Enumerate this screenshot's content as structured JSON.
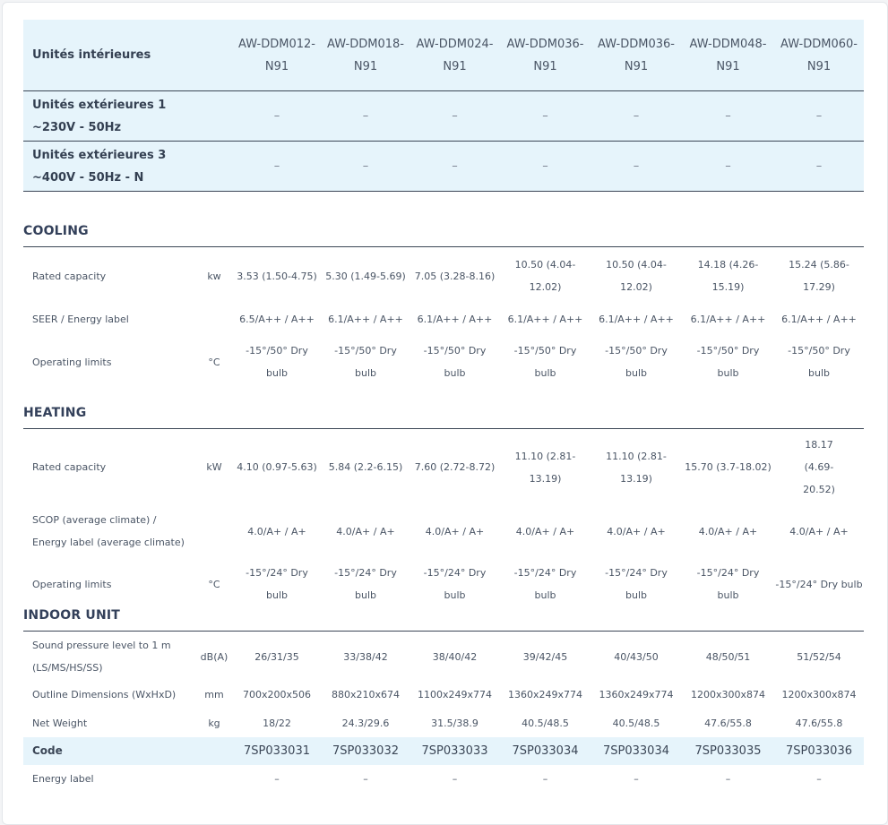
{
  "models": [
    "AW-DDM012-N91",
    "AW-DDM018-N91",
    "AW-DDM024-N91",
    "AW-DDM036-N91",
    "AW-DDM036-N91",
    "AW-DDM048-N91",
    "AW-DDM060-N91"
  ],
  "header": {
    "indoor_label": "Unités intérieures",
    "outdoor1_label_line1": "Unités extérieures 1",
    "outdoor1_label_line2": "~230V - 50Hz",
    "outdoor3_label_line1": "Unités extérieures 3",
    "outdoor3_label_line2": "~400V - 50Hz - N",
    "outdoor1_values": [
      "–",
      "–",
      "–",
      "–",
      "–",
      "–",
      "–"
    ],
    "outdoor3_values": [
      "–",
      "–",
      "–",
      "–",
      "–",
      "–",
      "–"
    ]
  },
  "cooling": {
    "title": "COOLING",
    "rated_capacity": {
      "label": "Rated capacity",
      "unit": "kw",
      "values": [
        "3.53 (1.50-4.75)",
        "5.30 (1.49-5.69)",
        "7.05 (3.28-8.16)",
        "10.50 (4.04-12.02)",
        "10.50 (4.04-12.02)",
        "14.18 (4.26-15.19)",
        "15.24 (5.86-17.29)"
      ]
    },
    "seer": {
      "label": "SEER / Energy label",
      "unit": "",
      "values": [
        "6.5/A++ / A++",
        "6.1/A++ / A++",
        "6.1/A++ / A++",
        "6.1/A++ / A++",
        "6.1/A++ / A++",
        "6.1/A++ / A++",
        "6.1/A++ / A++"
      ]
    },
    "operating_limits": {
      "label": "Operating limits",
      "unit": "°C",
      "values": [
        "-15°/50° Dry bulb",
        "-15°/50° Dry bulb",
        "-15°/50° Dry bulb",
        "-15°/50° Dry bulb",
        "-15°/50° Dry bulb",
        "-15°/50° Dry bulb",
        "-15°/50° Dry bulb"
      ]
    }
  },
  "heating": {
    "title": "HEATING",
    "rated_capacity": {
      "label": "Rated capacity",
      "unit": "kW",
      "values": [
        "4.10 (0.97-5.63)",
        "5.84 (2.2-6.15)",
        "7.60 (2.72-8.72)",
        "11.10 (2.81-13.19)",
        "11.10 (2.81-13.19)",
        "15.70 (3.7-18.02)",
        "18.17 (4.69-20.52)"
      ]
    },
    "scop": {
      "label": "SCOP (average climate) / Energy label (average climate)",
      "unit": "",
      "values": [
        "4.0/A+ / A+",
        "4.0/A+ / A+",
        "4.0/A+ / A+",
        "4.0/A+ / A+",
        "4.0/A+ / A+",
        "4.0/A+ / A+",
        "4.0/A+ / A+"
      ]
    },
    "operating_limits": {
      "label": "Operating limits",
      "unit": "°C",
      "values": [
        "-15°/24° Dry bulb",
        "-15°/24° Dry bulb",
        "-15°/24° Dry bulb",
        "-15°/24° Dry bulb",
        "-15°/24° Dry bulb",
        "-15°/24° Dry bulb",
        "-15°/24° Dry bulb"
      ]
    }
  },
  "indoor": {
    "title": "INDOOR UNIT",
    "sound": {
      "label": "Sound pressure level to 1 m (LS/MS/HS/SS)",
      "unit": "dB(A)",
      "values": [
        "26/31/35",
        "33/38/42",
        "38/40/42",
        "39/42/45",
        "40/43/50",
        "48/50/51",
        "51/52/54"
      ]
    },
    "dimensions": {
      "label": "Outline Dimensions (WxHxD)",
      "unit": "mm",
      "values": [
        "700x200x506",
        "880x210x674",
        "1100x249x774",
        "1360x249x774",
        "1360x249x774",
        "1200x300x874",
        "1200x300x874"
      ]
    },
    "weight": {
      "label": "Net Weight",
      "unit": "kg",
      "values": [
        "18/22",
        "24.3/29.6",
        "31.5/38.9",
        "40.5/48.5",
        "40.5/48.5",
        "47.6/55.8",
        "47.6/55.8"
      ]
    },
    "code": {
      "label": "Code",
      "unit": "",
      "values": [
        "7SP033031",
        "7SP033032",
        "7SP033033",
        "7SP033034",
        "7SP033034",
        "7SP033035",
        "7SP033036"
      ]
    },
    "energy_label": {
      "label": "Energy label",
      "unit": "",
      "values": [
        "–",
        "–",
        "–",
        "–",
        "–",
        "–",
        "–"
      ]
    }
  }
}
